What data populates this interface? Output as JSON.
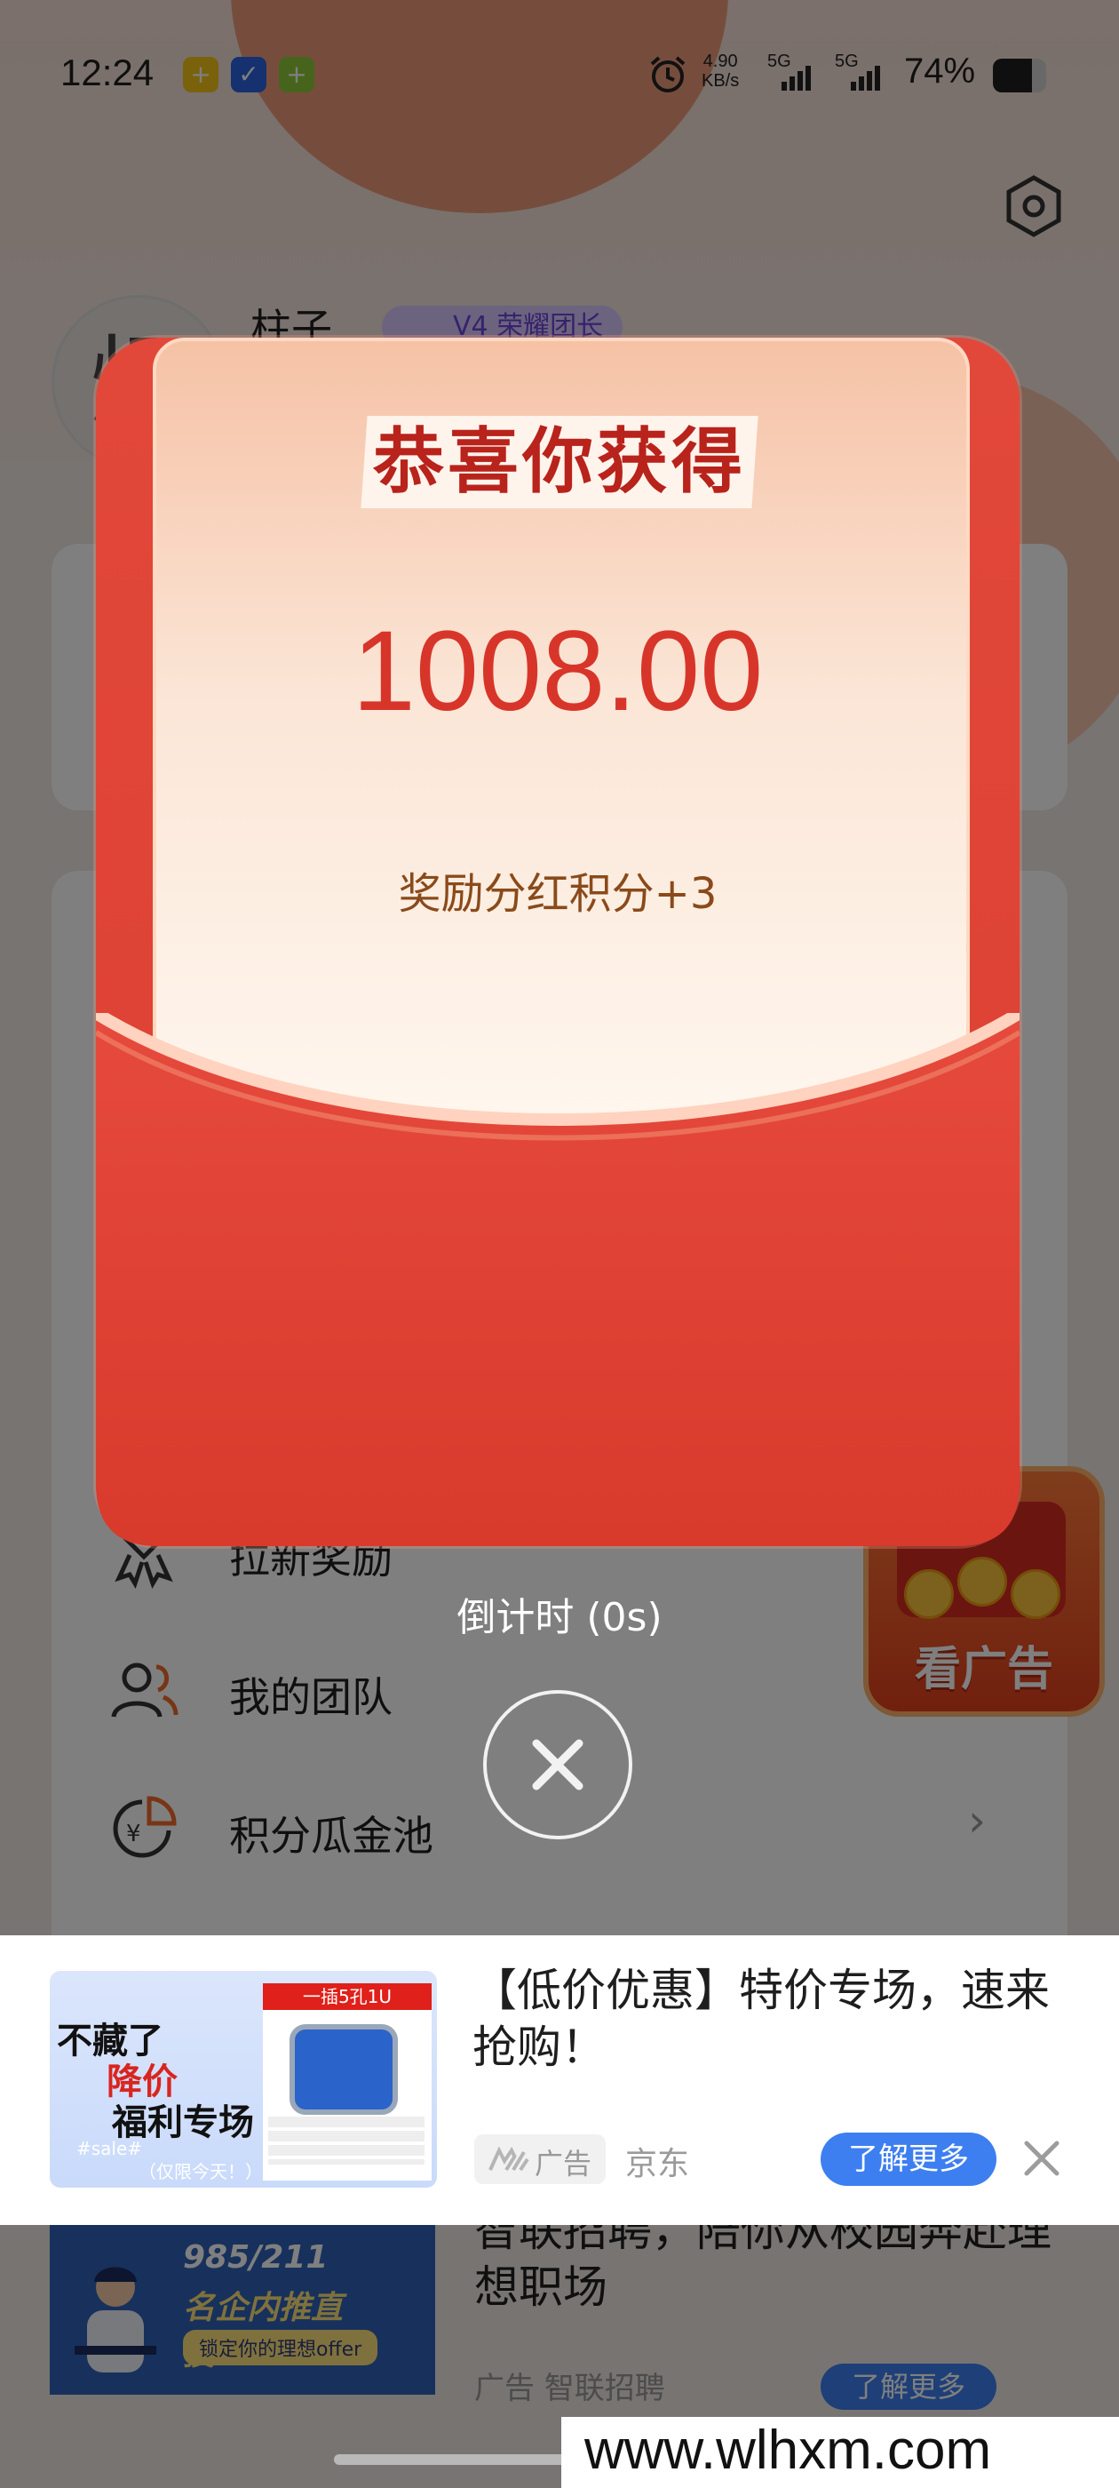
{
  "status_bar": {
    "time": "12:24",
    "net_speed_value": "4.90",
    "net_speed_unit": "KB/s",
    "network1": "5G",
    "network2": "5G",
    "battery_percent": "74%",
    "battery_level": 0.74
  },
  "profile": {
    "avatar_glyph": "烟",
    "name": "柱子",
    "level_badge": "V4 荣耀团长"
  },
  "menu": {
    "items": [
      {
        "label": "拉新奖励",
        "icon": "gift-ribbon-icon"
      },
      {
        "label": "我的团队",
        "icon": "team-icon"
      },
      {
        "label": "积分瓜金池",
        "icon": "coin-pie-icon"
      }
    ]
  },
  "floating_ad": {
    "label": "看广告"
  },
  "red_envelope": {
    "heading": "恭喜你获得",
    "amount": "1008.00",
    "reward_text": "奖励分红积分+3",
    "countdown": "倒计时 (0s)",
    "colors": {
      "envelope": "#db3f31",
      "amount": "#d8352a"
    }
  },
  "bottom_ad": {
    "image_line1": "不藏了",
    "image_line2": "降价",
    "image_line3": "福利专场",
    "image_line4": "#sale#",
    "image_line5": "（仅限今天！）",
    "image_panel_header": "一插5孔1U",
    "title": "【低价优惠】特价专场，速来抢购！",
    "tag": "广告",
    "source": "京东",
    "cta": "了解更多"
  },
  "lower_ad": {
    "image_line1": "985/211",
    "image_line2": "名企内推直投！！",
    "image_line3": "锁定你的理想offer",
    "title": "智联招聘，陪你从校园奔赴理想职场",
    "meta": "广告   智联招聘",
    "cta": "了解更多"
  },
  "watermark": "www.wlhxm.com"
}
